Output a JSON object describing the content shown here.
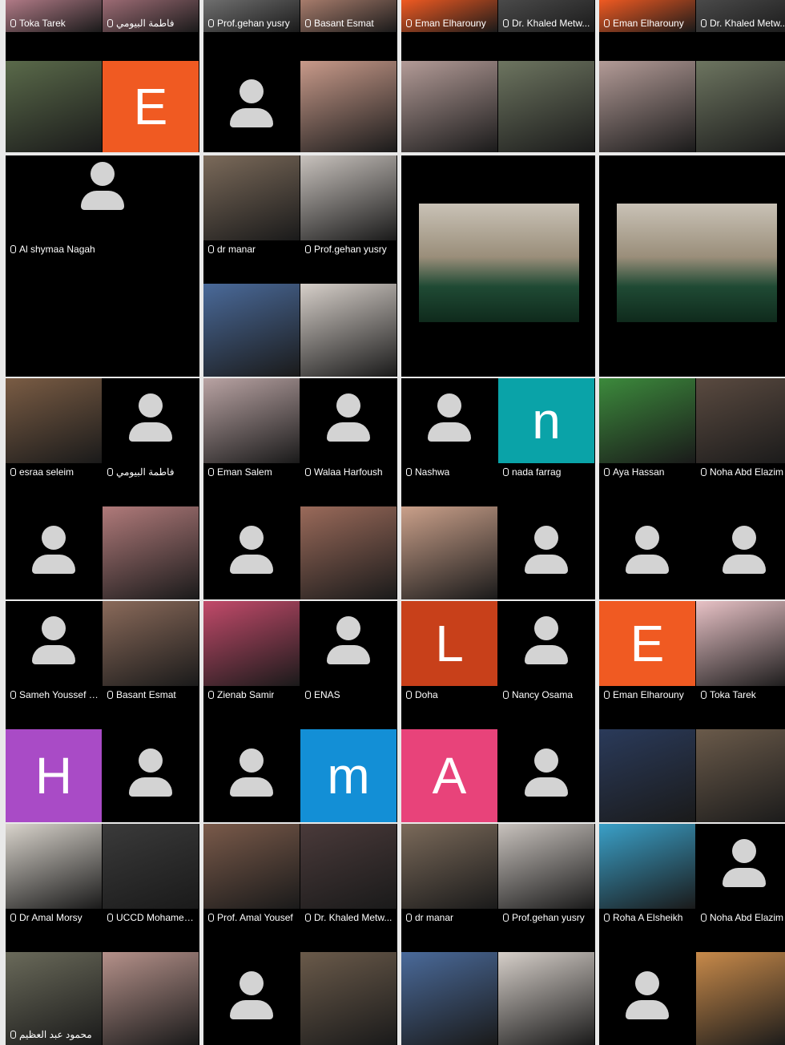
{
  "panels": [
    {
      "tiles": [
        {
          "name": "Toka Tarek",
          "kind": "photo",
          "color": "#b07a86"
        },
        {
          "name": "فاطمة البيومي",
          "kind": "photo",
          "color": "#9c6b74"
        },
        {
          "name": "",
          "kind": "photo",
          "color": "#5a6a4a"
        },
        {
          "name": "",
          "kind": "initial",
          "initial": "E",
          "color": "#f05a22"
        }
      ]
    },
    {
      "tiles": [
        {
          "name": "Prof.gehan yusry",
          "kind": "photo",
          "color": "#6f6f6f"
        },
        {
          "name": "Basant Esmat",
          "kind": "photo",
          "color": "#a77c6c"
        },
        {
          "name": "",
          "kind": "avatar"
        },
        {
          "name": "",
          "kind": "photo",
          "color": "#c89a8a"
        }
      ]
    },
    {
      "tiles": [
        {
          "name": "Eman Elharouny",
          "kind": "photo",
          "color": "#f05a22"
        },
        {
          "name": "Dr. Khaled Metw...",
          "kind": "photo",
          "color": "#4a4a4a"
        },
        {
          "name": "",
          "kind": "photo",
          "color": "#b39b97"
        },
        {
          "name": "",
          "kind": "photo",
          "color": "#6d7560"
        }
      ]
    },
    {
      "tiles": [
        {
          "name": "Eman Elharouny",
          "kind": "photo",
          "color": "#f05a22"
        },
        {
          "name": "Dr. Khaled Metw...",
          "kind": "photo",
          "color": "#4a4a4a"
        },
        {
          "name": "",
          "kind": "photo",
          "color": "#b39b97"
        },
        {
          "name": "",
          "kind": "photo",
          "color": "#6d7560"
        }
      ]
    },
    {
      "tiles": [
        {
          "name": "Al shymaa Nagah",
          "kind": "avatar-single"
        }
      ]
    },
    {
      "tiles": [
        {
          "name": "dr manar",
          "kind": "photo",
          "color": "#7b6a5a"
        },
        {
          "name": "Prof.gehan yusry",
          "kind": "photo",
          "color": "#c8c2bd"
        },
        {
          "name": "",
          "kind": "photo",
          "color": "#4a6a9a"
        },
        {
          "name": "",
          "kind": "photo",
          "color": "#d6cfc9"
        }
      ]
    },
    {
      "tiles": [
        {
          "name": "",
          "kind": "video",
          "color": "#2f4a3a"
        }
      ]
    },
    {
      "tiles": [
        {
          "name": "",
          "kind": "video",
          "color": "#2f4a3a"
        }
      ]
    },
    {
      "tiles": [
        {
          "name": "esraa seleim",
          "kind": "photo",
          "color": "#7a5c44"
        },
        {
          "name": "فاطمة البيومي",
          "kind": "avatar"
        },
        {
          "name": "",
          "kind": "avatar"
        },
        {
          "name": "",
          "kind": "photo",
          "color": "#b07a7a"
        }
      ]
    },
    {
      "tiles": [
        {
          "name": "Eman Salem",
          "kind": "photo",
          "color": "#b9a3a3"
        },
        {
          "name": "Walaa Harfoush",
          "kind": "avatar"
        },
        {
          "name": "",
          "kind": "avatar"
        },
        {
          "name": "",
          "kind": "photo",
          "color": "#9a6a5a"
        }
      ]
    },
    {
      "tiles": [
        {
          "name": "Nashwa",
          "kind": "avatar"
        },
        {
          "name": "nada farrag",
          "kind": "initial",
          "initial": "n",
          "color": "#0aa3a8"
        },
        {
          "name": "",
          "kind": "photo",
          "color": "#caa08a"
        },
        {
          "name": "",
          "kind": "avatar"
        }
      ]
    },
    {
      "tiles": [
        {
          "name": "Aya Hassan",
          "kind": "photo",
          "color": "#3c8a3c"
        },
        {
          "name": "Noha Abd Elazim",
          "kind": "photo",
          "color": "#5a4a40"
        },
        {
          "name": "",
          "kind": "avatar"
        },
        {
          "name": "",
          "kind": "avatar"
        }
      ]
    },
    {
      "tiles": [
        {
          "name": "Sameh Youssef (...",
          "kind": "avatar"
        },
        {
          "name": "Basant Esmat",
          "kind": "photo",
          "color": "#8a6a5a"
        },
        {
          "name": "",
          "kind": "initial",
          "initial": "H",
          "color": "#a94bc6"
        },
        {
          "name": "",
          "kind": "avatar"
        }
      ]
    },
    {
      "tiles": [
        {
          "name": "Zienab Samir",
          "kind": "photo",
          "color": "#c24a6a"
        },
        {
          "name": "ENAS",
          "kind": "avatar"
        },
        {
          "name": "",
          "kind": "avatar"
        },
        {
          "name": "",
          "kind": "initial",
          "initial": "m",
          "color": "#138fd6"
        }
      ]
    },
    {
      "tiles": [
        {
          "name": "Doha",
          "kind": "initial",
          "initial": "L",
          "color": "#c8401a"
        },
        {
          "name": "Nancy Osama",
          "kind": "avatar"
        },
        {
          "name": "",
          "kind": "initial",
          "initial": "A",
          "color": "#e8437a"
        },
        {
          "name": "",
          "kind": "avatar"
        }
      ]
    },
    {
      "tiles": [
        {
          "name": "Eman Elharouny",
          "kind": "initial",
          "initial": "E",
          "color": "#f05a22"
        },
        {
          "name": "Toka Tarek",
          "kind": "photo",
          "color": "#e8c2c6"
        },
        {
          "name": "",
          "kind": "photo",
          "color": "#2a3a5a"
        },
        {
          "name": "",
          "kind": "photo",
          "color": "#6a5a4a"
        }
      ]
    },
    {
      "tiles": [
        {
          "name": "Dr Amal Morsy",
          "kind": "photo",
          "color": "#d9d4cc"
        },
        {
          "name": "UCCD Mohamed ...",
          "kind": "photo",
          "color": "#3a3a3a"
        },
        {
          "name": "محمود عبد العظيم",
          "kind": "photo",
          "color": "#6a6a5a"
        },
        {
          "name": "",
          "kind": "photo",
          "color": "#b5918a"
        }
      ]
    },
    {
      "tiles": [
        {
          "name": "Prof. Amal Yousef",
          "kind": "photo",
          "color": "#7a5a4a"
        },
        {
          "name": "Dr. Khaled Metw...",
          "kind": "photo",
          "color": "#4a3a3a"
        },
        {
          "name": "",
          "kind": "avatar"
        },
        {
          "name": "",
          "kind": "photo",
          "color": "#6a5a4a"
        }
      ]
    },
    {
      "tiles": [
        {
          "name": "dr manar",
          "kind": "photo",
          "color": "#7b6a5a"
        },
        {
          "name": "Prof.gehan yusry",
          "kind": "photo",
          "color": "#c8c2bd"
        },
        {
          "name": "",
          "kind": "photo",
          "color": "#4a6a9a"
        },
        {
          "name": "",
          "kind": "photo",
          "color": "#d6cfc9"
        }
      ]
    },
    {
      "tiles": [
        {
          "name": "Roha A Elsheikh",
          "kind": "photo",
          "color": "#3aa0c8"
        },
        {
          "name": "Noha Abd Elazim",
          "kind": "avatar"
        },
        {
          "name": "",
          "kind": "avatar"
        },
        {
          "name": "",
          "kind": "photo",
          "color": "#c88a4a"
        }
      ]
    }
  ]
}
